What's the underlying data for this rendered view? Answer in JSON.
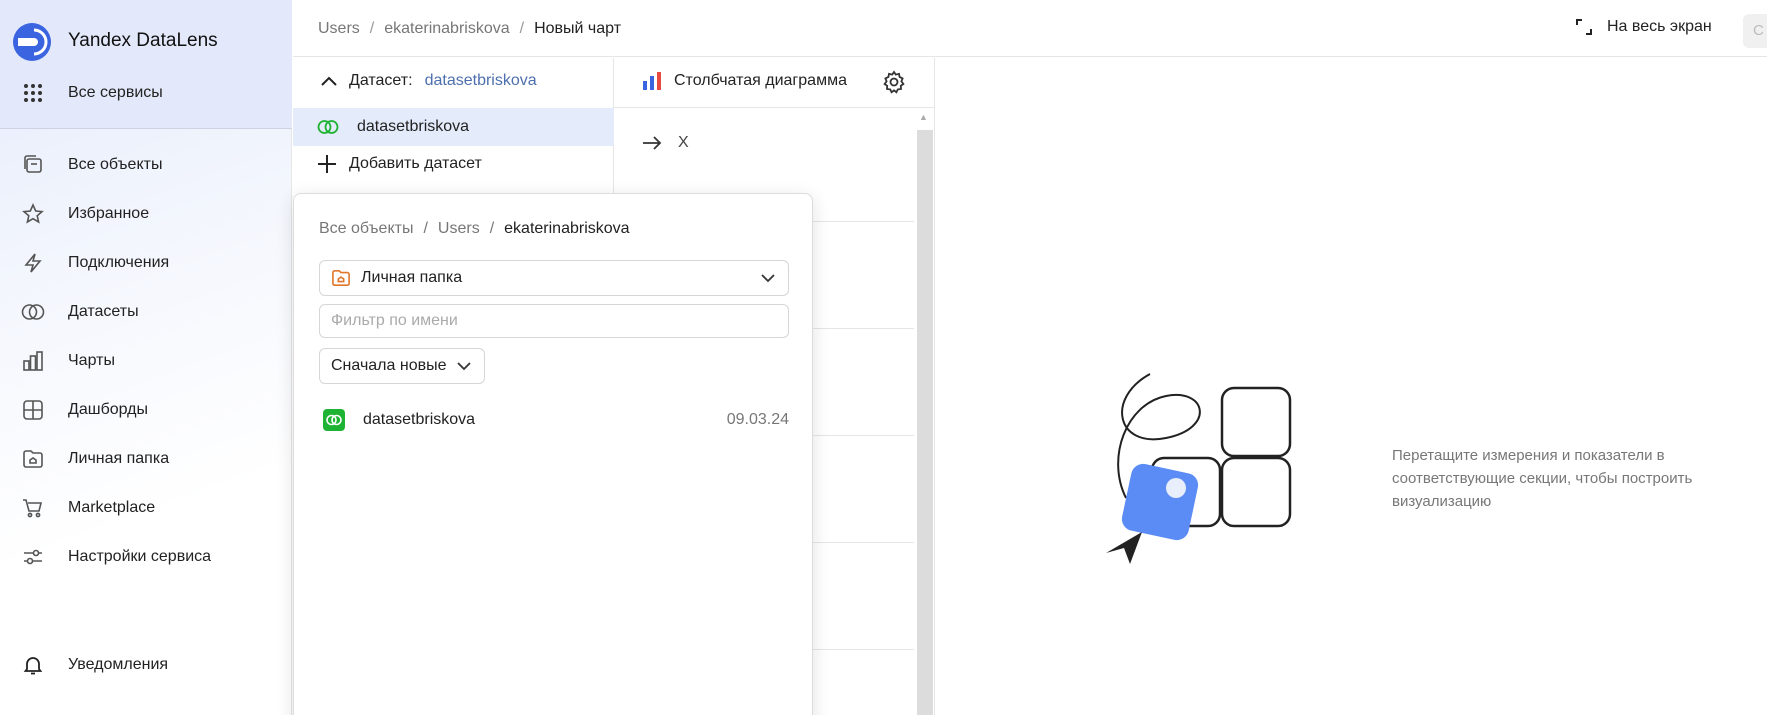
{
  "sidebar": {
    "brand": "Yandex DataLens",
    "all_services": "Все сервисы",
    "items": [
      {
        "label": "Все объекты",
        "icon": "folders-icon"
      },
      {
        "label": "Избранное",
        "icon": "star-icon"
      },
      {
        "label": "Подключения",
        "icon": "lightning-icon"
      },
      {
        "label": "Датасеты",
        "icon": "dataset-circles-icon"
      },
      {
        "label": "Чарты",
        "icon": "bar-chart-icon"
      },
      {
        "label": "Дашборды",
        "icon": "dashboard-grid-icon"
      },
      {
        "label": "Личная папка",
        "icon": "personal-folder-icon"
      },
      {
        "label": "Marketplace",
        "icon": "cart-icon"
      },
      {
        "label": "Настройки сервиса",
        "icon": "sliders-icon"
      }
    ],
    "notifications": "Уведомления"
  },
  "header": {
    "breadcrumbs": [
      "Users",
      "ekaterinabriskova",
      "Новый чарт"
    ],
    "fullscreen_label": "На весь экран",
    "cut_button_label": "С"
  },
  "dataset_panel": {
    "dataset_label": "Датасет:",
    "dataset_value": "datasetbriskova",
    "selected_dataset": "datasetbriskova",
    "add_dataset": "Добавить датасет"
  },
  "sections_panel": {
    "chart_type": "Столбчатая диаграмма",
    "x_section": "X"
  },
  "popup": {
    "breadcrumbs": [
      "Все объекты",
      "Users",
      "ekaterinabriskova"
    ],
    "folder_select": "Личная папка",
    "filter_placeholder": "Фильтр по имени",
    "sort_label": "Сначала новые",
    "items": [
      {
        "name": "datasetbriskova",
        "date": "09.03.24"
      }
    ]
  },
  "canvas": {
    "hint": "Перетащите измерения и показатели в соответствующие секции, чтобы построить визуализацию"
  },
  "colors": {
    "accent": "#4d6fae",
    "sidebar_bg": "#e3e9fb",
    "dataset_green": "#1fb334",
    "illustration_blue": "#5b8cf5"
  }
}
